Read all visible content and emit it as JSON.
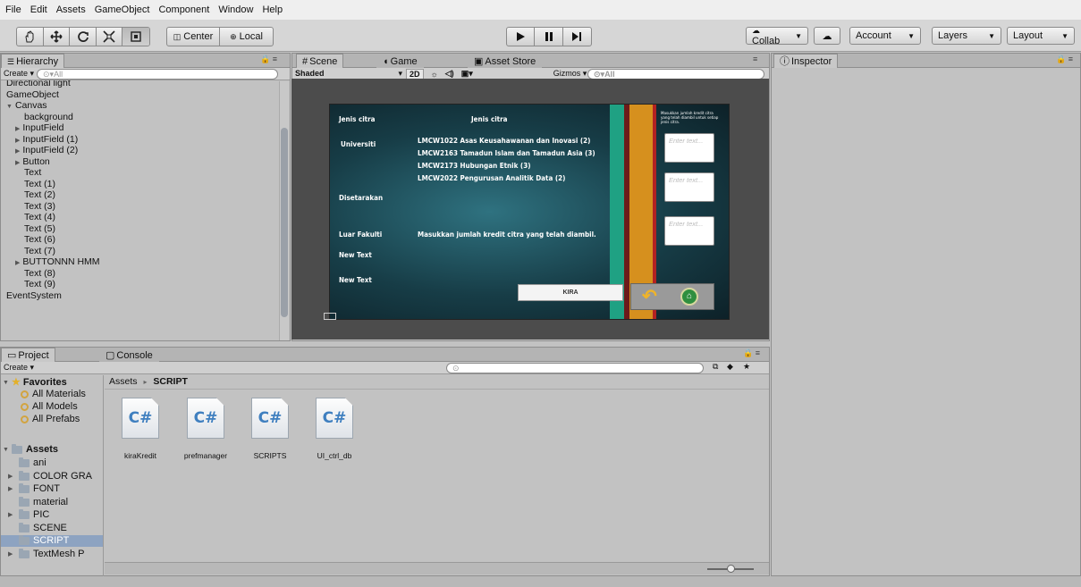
{
  "menu": [
    "File",
    "Edit",
    "Assets",
    "GameObject",
    "Component",
    "Window",
    "Help"
  ],
  "toolbar": {
    "pivot": "Center",
    "space": "Local",
    "collab": "Collab",
    "account": "Account",
    "layers": "Layers",
    "layout": "Layout"
  },
  "hierarchy": {
    "tab": "Hierarchy",
    "create": "Create",
    "search_placeholder": "All",
    "items": [
      {
        "label": "Directional light",
        "indent": 0,
        "arrow": ""
      },
      {
        "label": "GameObject",
        "indent": 0,
        "arrow": ""
      },
      {
        "label": "Canvas",
        "indent": 0,
        "arrow": "▼"
      },
      {
        "label": "background",
        "indent": 2,
        "arrow": ""
      },
      {
        "label": "InputField",
        "indent": 1,
        "arrow": "▶"
      },
      {
        "label": "InputField (1)",
        "indent": 1,
        "arrow": "▶"
      },
      {
        "label": "InputField (2)",
        "indent": 1,
        "arrow": "▶"
      },
      {
        "label": "Button",
        "indent": 1,
        "arrow": "▶"
      },
      {
        "label": "Text",
        "indent": 2,
        "arrow": ""
      },
      {
        "label": "Text (1)",
        "indent": 2,
        "arrow": ""
      },
      {
        "label": "Text (2)",
        "indent": 2,
        "arrow": ""
      },
      {
        "label": "Text (3)",
        "indent": 2,
        "arrow": ""
      },
      {
        "label": "Text (4)",
        "indent": 2,
        "arrow": ""
      },
      {
        "label": "Text (5)",
        "indent": 2,
        "arrow": ""
      },
      {
        "label": "Text (6)",
        "indent": 2,
        "arrow": ""
      },
      {
        "label": "Text (7)",
        "indent": 2,
        "arrow": ""
      },
      {
        "label": "BUTTONNN HMM",
        "indent": 1,
        "arrow": "▶"
      },
      {
        "label": "Text (8)",
        "indent": 2,
        "arrow": ""
      },
      {
        "label": "Text (9)",
        "indent": 2,
        "arrow": ""
      },
      {
        "label": "EventSystem",
        "indent": 0,
        "arrow": ""
      }
    ]
  },
  "scene": {
    "tabs": [
      "Scene",
      "Game",
      "Asset Store"
    ],
    "shading": "Shaded",
    "mode_2d": "2D",
    "gizmos": "Gizmos",
    "search_placeholder": "All",
    "canvas": {
      "label_jenis": "Jenis citra",
      "header_jenis": "Jenis citra",
      "label_universiti": "Universiti",
      "courses": [
        "LMCW1022 Asas Keusahawanan dan Inovasi (2)",
        "LMCW2163 Tamadun Islam dan Tamadun Asia (3)",
        "LMCW2173 Hubungan Etnik (3)",
        "LMCW2022 Pengurusan Analitik Data (2)"
      ],
      "label_disetarakan": "Disetarakan",
      "label_luar": "Luar Fakulti",
      "luar_prompt": "Masukkan jumlah kredit citra yang telah diambil.",
      "new_text_1": "New Text",
      "new_text_2": "New Text",
      "right_note": "Masukkan jumlah kredit citra yang telah diambil untuk setiap jenis citra.",
      "input_placeholder": "Enter text...",
      "kira": "KIRA"
    }
  },
  "inspector": {
    "tab": "Inspector"
  },
  "project": {
    "tabs": [
      "Project",
      "Console"
    ],
    "create": "Create",
    "favorites_title": "Favorites",
    "favorites": [
      "All Materials",
      "All Models",
      "All Prefabs"
    ],
    "assets_title": "Assets",
    "folders": [
      {
        "label": "ani",
        "arrow": ""
      },
      {
        "label": "COLOR GRA",
        "arrow": "▶"
      },
      {
        "label": "FONT",
        "arrow": "▶"
      },
      {
        "label": "material",
        "arrow": ""
      },
      {
        "label": "PIC",
        "arrow": "▶"
      },
      {
        "label": "SCENE",
        "arrow": ""
      },
      {
        "label": "SCRIPT",
        "arrow": "",
        "selected": true
      },
      {
        "label": "TextMesh P",
        "arrow": "▶"
      }
    ],
    "breadcrumb_root": "Assets",
    "breadcrumb_current": "SCRIPT",
    "scripts": [
      "kiraKredit",
      "prefmanager",
      "SCRIPTS",
      "UI_ctrl_db"
    ]
  },
  "colors": {
    "accent_selected": "#8da3c1",
    "teal": "#1fa183",
    "orange": "#d6901e",
    "red": "#b32222"
  }
}
